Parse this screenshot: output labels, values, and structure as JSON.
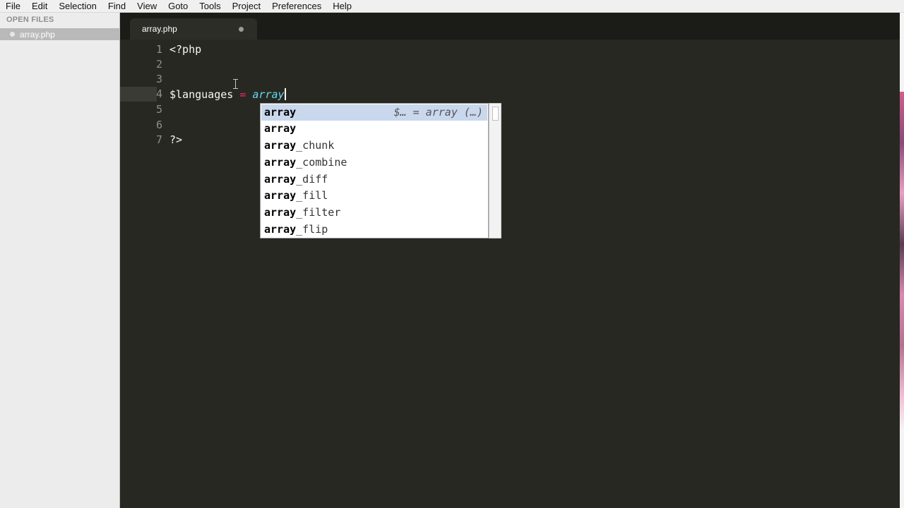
{
  "menubar": {
    "items": [
      "File",
      "Edit",
      "Selection",
      "Find",
      "View",
      "Goto",
      "Tools",
      "Project",
      "Preferences",
      "Help"
    ]
  },
  "sidebar": {
    "header": "OPEN FILES",
    "files": [
      {
        "name": "array.php",
        "icon": "dot-icon"
      }
    ]
  },
  "tabbar": {
    "tabs": [
      {
        "label": "array.php",
        "dirty_indicator": "dot-icon"
      }
    ]
  },
  "editor": {
    "line_numbers": [
      "1",
      "2",
      "3",
      "4",
      "5",
      "6",
      "7"
    ],
    "current_line": "4",
    "lines": {
      "l1": "<?php",
      "l4_var": "$languages",
      "l4_op": "=",
      "l4_fn": "array",
      "l7": "?>"
    }
  },
  "autocomplete": {
    "items": [
      {
        "match": "array",
        "rest": "",
        "hint": "$… = array (…)"
      },
      {
        "match": "array",
        "rest": "",
        "hint": ""
      },
      {
        "match": "array",
        "rest": "_chunk",
        "hint": ""
      },
      {
        "match": "array",
        "rest": "_combine",
        "hint": ""
      },
      {
        "match": "array",
        "rest": "_diff",
        "hint": ""
      },
      {
        "match": "array",
        "rest": "_fill",
        "hint": ""
      },
      {
        "match": "array",
        "rest": "_filter",
        "hint": ""
      },
      {
        "match": "array",
        "rest": "_flip",
        "hint": ""
      }
    ],
    "selected_index": 0
  },
  "colors": {
    "editor_bg": "#272822",
    "keyword": "#f92672",
    "function": "#66d9ef",
    "text": "#f8f8f2",
    "selection_bg": "#cad8ee"
  }
}
